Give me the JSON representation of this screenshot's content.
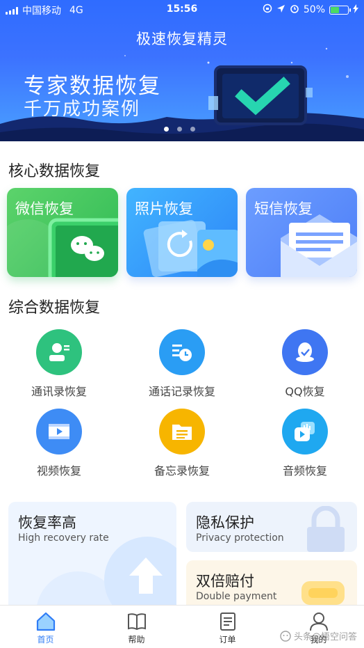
{
  "status_bar": {
    "carrier": "中国移动",
    "network": "4G",
    "time": "15:56",
    "battery": "50%",
    "battery_level": 0.5
  },
  "header": {
    "title": "极速恢复精灵"
  },
  "banner": {
    "headline": "专家数据恢复",
    "subline": "千万成功案例",
    "page_count": 3,
    "active_page": 1
  },
  "core": {
    "title": "核心数据恢复",
    "cards": [
      {
        "label": "微信恢复",
        "icon": "wechat-icon"
      },
      {
        "label": "照片恢复",
        "icon": "photo-icon"
      },
      {
        "label": "短信恢复",
        "icon": "envelope-icon"
      }
    ]
  },
  "general": {
    "title": "综合数据恢复",
    "items": [
      {
        "label": "通讯录恢复",
        "icon": "contact-icon",
        "color": "#2ec27e"
      },
      {
        "label": "通话记录恢复",
        "icon": "call-log-icon",
        "color": "#2a9df4"
      },
      {
        "label": "QQ恢复",
        "icon": "qq-icon",
        "color": "#3f76f2"
      },
      {
        "label": "视频恢复",
        "icon": "video-icon",
        "color": "#3e8cf5"
      },
      {
        "label": "备忘录恢复",
        "icon": "notes-icon",
        "color": "#f7b500"
      },
      {
        "label": "音频恢复",
        "icon": "audio-icon",
        "color": "#1fa8f0"
      }
    ]
  },
  "features": [
    {
      "title": "恢复率高",
      "subtitle": "High recovery rate"
    },
    {
      "title": "隐私保护",
      "subtitle": "Privacy protection"
    },
    {
      "title": "双倍赔付",
      "subtitle": "Double payment"
    }
  ],
  "tabbar": {
    "tabs": [
      {
        "label": "首页",
        "icon": "home-icon",
        "active": true
      },
      {
        "label": "帮助",
        "icon": "book-icon",
        "active": false
      },
      {
        "label": "订单",
        "icon": "order-icon",
        "active": false
      },
      {
        "label": "我的",
        "icon": "user-icon",
        "active": false
      }
    ]
  },
  "watermark": {
    "text": "头条@悟空问答"
  }
}
